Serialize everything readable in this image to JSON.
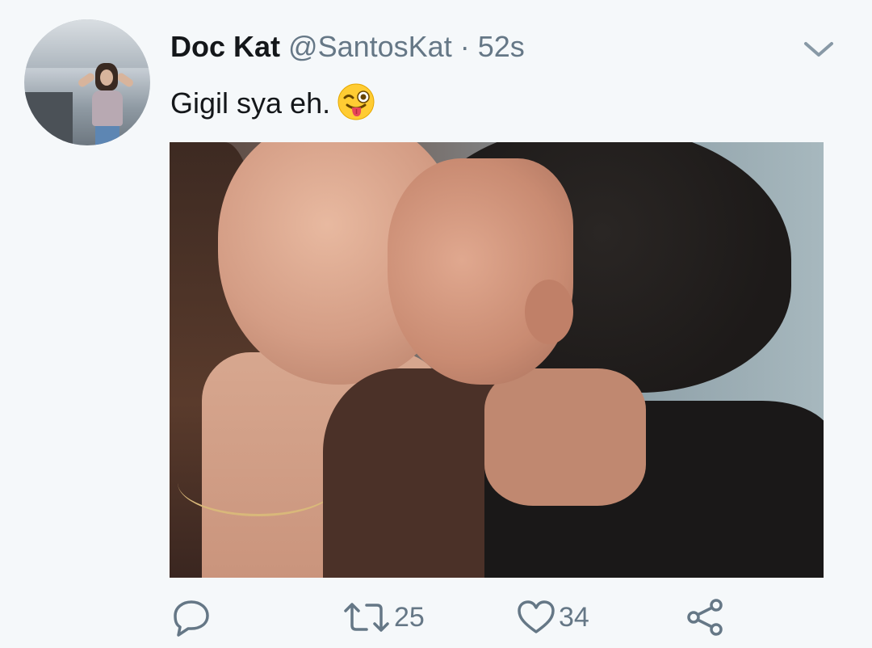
{
  "tweet": {
    "display_name": "Doc Kat",
    "handle": "@SantosKat",
    "separator": "·",
    "timestamp": "52s",
    "text": "Gigil sya eh.",
    "emoji": "winking-face-with-tongue"
  },
  "actions": {
    "reply_count": "",
    "retweet_count": "25",
    "like_count": "34"
  },
  "colors": {
    "background": "#f5f8fa",
    "primary_text": "#14171a",
    "secondary_text": "#657786",
    "icon": "#657786"
  },
  "icons": [
    "chevron-down-icon",
    "reply-icon",
    "retweet-icon",
    "heart-icon",
    "share-icon"
  ]
}
